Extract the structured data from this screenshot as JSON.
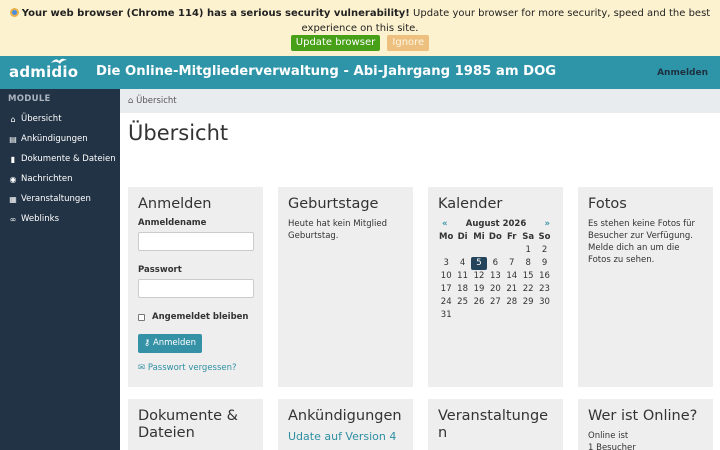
{
  "banner": {
    "bold_text": "Your web browser (Chrome 114) has a serious security vulnerability!",
    "text": " Update your browser for more security, speed and the best experience on this site.",
    "update_label": "Update browser",
    "ignore_label": "Ignore"
  },
  "header": {
    "logo": "admidio",
    "title": "Die Online-Mitgliederverwaltung - Abi-Jahrgang 1985 am DOG",
    "login_label": "Anmelden"
  },
  "sidebar": {
    "section": "MODULE",
    "items": [
      {
        "icon": "home-icon",
        "label": "Übersicht"
      },
      {
        "icon": "newspaper-icon",
        "label": "Ankündigungen"
      },
      {
        "icon": "file-icon",
        "label": "Dokumente & Dateien"
      },
      {
        "icon": "comments-icon",
        "label": "Nachrichten"
      },
      {
        "icon": "calendar-icon",
        "label": "Veranstaltungen"
      },
      {
        "icon": "link-icon",
        "label": "Weblinks"
      }
    ]
  },
  "breadcrumb": {
    "label": "Übersicht"
  },
  "page": {
    "title": "Übersicht"
  },
  "login_card": {
    "title": "Anmelden",
    "username_label": "Anmeldename",
    "password_label": "Passwort",
    "remember_label": "Angemeldet bleiben",
    "button_label": "Anmelden",
    "forgot_label": "Passwort vergessen?"
  },
  "birthday_card": {
    "title": "Geburtstage",
    "text": "Heute hat kein Mitglied Geburtstag."
  },
  "calendar_card": {
    "title": "Kalender",
    "prev": "«",
    "month": "August 2026",
    "next": "»",
    "weekdays": [
      "Mo",
      "Di",
      "Mi",
      "Do",
      "Fr",
      "Sa",
      "So"
    ],
    "weeks": [
      [
        "",
        "",
        "",
        "",
        "",
        "1",
        "2"
      ],
      [
        "3",
        "4",
        "5",
        "6",
        "7",
        "8",
        "9"
      ],
      [
        "10",
        "11",
        "12",
        "13",
        "14",
        "15",
        "16"
      ],
      [
        "17",
        "18",
        "19",
        "20",
        "21",
        "22",
        "23"
      ],
      [
        "24",
        "25",
        "26",
        "27",
        "28",
        "29",
        "30"
      ],
      [
        "31",
        "",
        "",
        "",
        "",
        "",
        ""
      ]
    ],
    "today": "5"
  },
  "photos_card": {
    "title": "Fotos",
    "text": "Es stehen keine Fotos für Besucher zur Verfügung. Melde dich an um die Fotos zu sehen."
  },
  "documents_card": {
    "title": "Dokumente & Dateien"
  },
  "announcements_card": {
    "title": "Ankündigungen",
    "link": "Udate auf Version 4"
  },
  "events_card": {
    "title": "Veranstaltungen"
  },
  "online_card": {
    "title": "Wer ist Online?",
    "line1": "Online ist",
    "line2": "1 Besucher"
  },
  "colors": {
    "header": "#2e94a8",
    "sidebar": "#223345",
    "banner": "#fdf2cf",
    "accent": "#3592a6"
  }
}
